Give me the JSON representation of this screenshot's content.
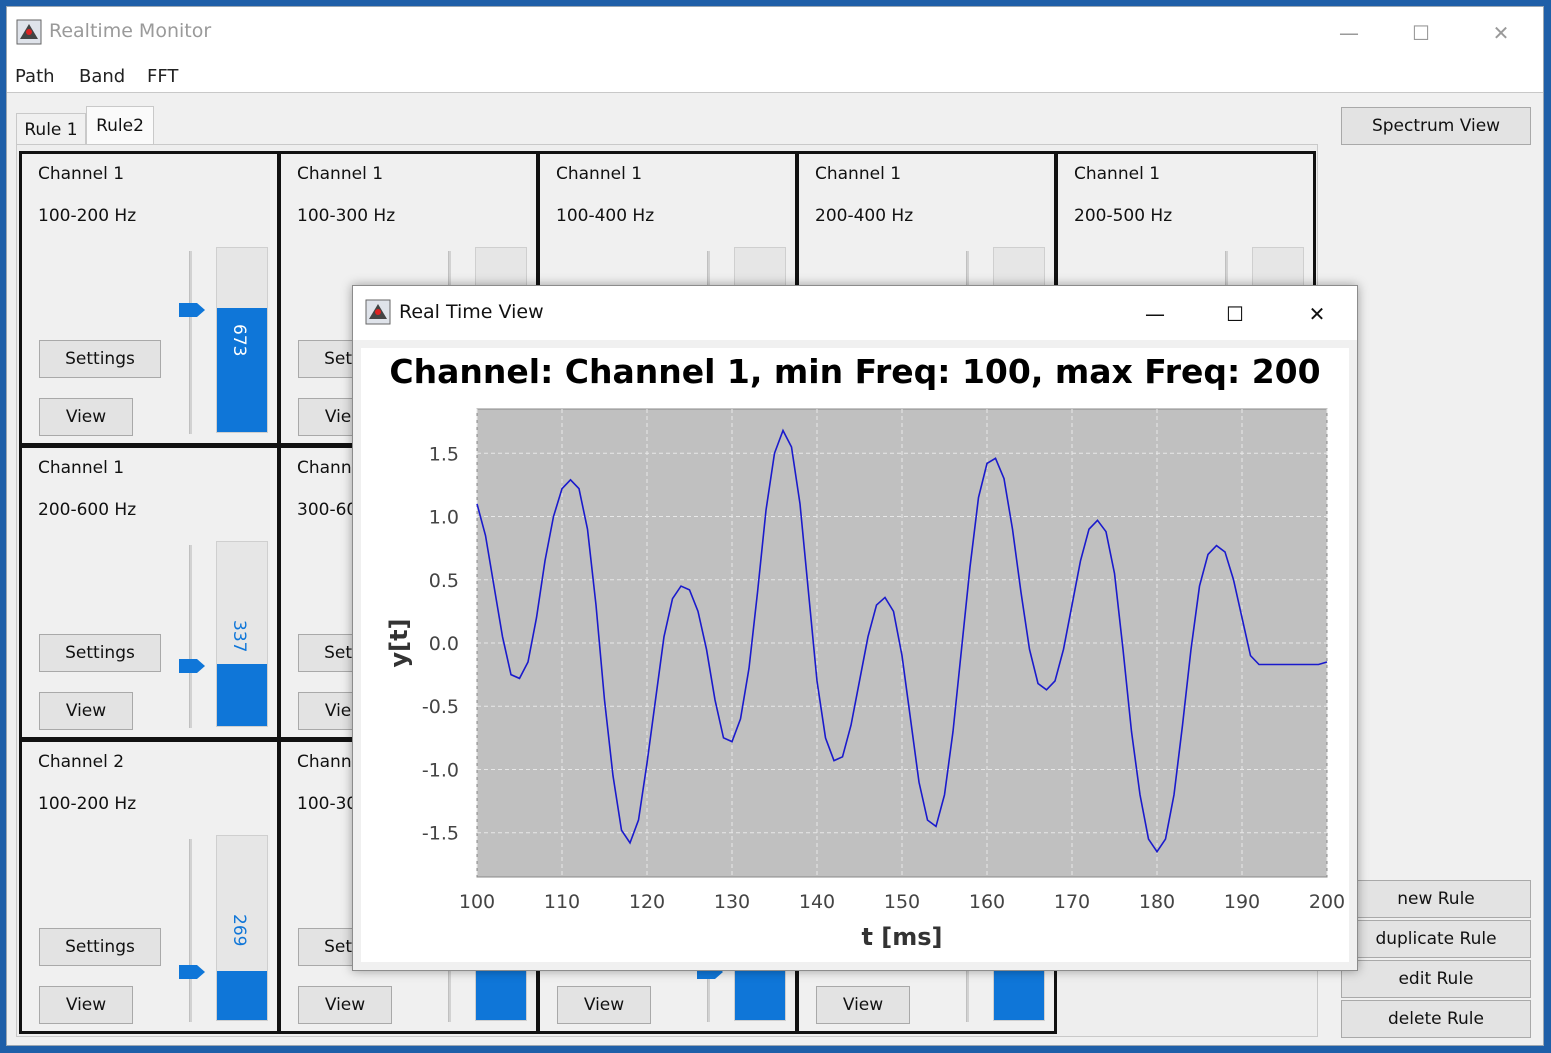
{
  "window": {
    "title": "Realtime Monitor",
    "minimize": "—",
    "maximize": "☐",
    "close": "✕"
  },
  "menu": [
    "Path",
    "Band",
    "FFT"
  ],
  "tabs": [
    "Rule 1",
    "Rule2"
  ],
  "colors": {
    "meter": "#0f76d8",
    "plot_bg": "#c0c0c0",
    "plot_line": "#1a1acc"
  },
  "cells": [
    {
      "channel": "Channel 1",
      "range": "100-200 Hz",
      "settings": "Settings",
      "view": "View",
      "value": "673",
      "level": 0.673
    },
    {
      "channel": "Channel 1",
      "range": "100-300 Hz",
      "settings": "Settings",
      "view": "View"
    },
    {
      "channel": "Channel 1",
      "range": "100-400 Hz"
    },
    {
      "channel": "Channel 1",
      "range": "200-400 Hz"
    },
    {
      "channel": "Channel 1",
      "range": "200-500 Hz"
    },
    {
      "channel": "Channel 1",
      "range": "200-600 Hz",
      "settings": "Settings",
      "view": "View",
      "value": "337",
      "level": 0.337
    },
    {
      "channel": "Channel 1",
      "range": "300-600 Hz",
      "settings": "Settings",
      "view": "View"
    },
    {
      "channel": "Channel 2",
      "range": "100-200 Hz",
      "settings": "Settings",
      "view": "View",
      "value": "269",
      "level": 0.269
    },
    {
      "channel": "Channel 2",
      "range": "100-300 Hz",
      "settings": "Settings",
      "view": "View"
    },
    {
      "view": "View"
    },
    {
      "view": "View"
    }
  ],
  "side_buttons": {
    "spectrum": "Spectrum View",
    "new": "new Rule",
    "duplicate": "duplicate Rule",
    "edit": "edit Rule",
    "delete": "delete Rule"
  },
  "realtime_window": {
    "title": "Real Time View",
    "minimize": "—",
    "maximize": "☐",
    "close": "✕"
  },
  "chart_data": {
    "type": "line",
    "title": "Channel: Channel 1, min Freq: 100, max Freq: 200",
    "xlabel": "t [ms]",
    "ylabel": "y[t]",
    "xlim": [
      100,
      200
    ],
    "ylim": [
      -1.85,
      1.85
    ],
    "xticks": [
      "100",
      "110",
      "120",
      "130",
      "140",
      "150",
      "160",
      "170",
      "180",
      "190",
      "200"
    ],
    "yticks": [
      "1.5",
      "1.0",
      "0.5",
      "0.0",
      "-0.5",
      "-1.0",
      "-1.5"
    ],
    "grid": true,
    "series": [
      {
        "x": [
          100,
          101,
          102,
          103,
          104,
          105,
          106,
          107,
          108,
          109,
          110,
          111,
          112,
          113,
          114,
          115,
          116,
          117,
          118,
          119,
          120,
          121,
          122,
          123,
          124,
          125,
          126,
          127,
          128,
          129,
          130,
          131,
          132,
          133,
          134,
          135,
          136,
          137,
          138,
          139,
          140,
          141,
          142,
          143,
          144,
          145,
          146,
          147,
          148,
          149,
          150,
          151,
          152,
          153,
          154,
          155,
          156,
          157,
          158,
          159,
          160,
          161,
          162,
          163,
          164,
          165,
          166,
          167,
          168,
          169,
          170,
          171,
          172,
          173,
          174,
          175,
          176,
          177,
          178,
          179,
          180,
          181,
          182,
          183,
          184,
          185,
          186,
          187,
          188,
          189,
          190,
          191,
          192,
          193,
          194,
          195,
          196,
          197,
          198,
          199,
          200
        ],
        "y": [
          1.1,
          0.85,
          0.45,
          0.05,
          -0.25,
          -0.28,
          -0.15,
          0.2,
          0.65,
          1.0,
          1.22,
          1.29,
          1.22,
          0.9,
          0.3,
          -0.45,
          -1.05,
          -1.48,
          -1.58,
          -1.4,
          -0.95,
          -0.45,
          0.05,
          0.35,
          0.45,
          0.42,
          0.25,
          -0.05,
          -0.45,
          -0.75,
          -0.78,
          -0.6,
          -0.2,
          0.4,
          1.05,
          1.5,
          1.68,
          1.55,
          1.1,
          0.4,
          -0.3,
          -0.75,
          -0.93,
          -0.9,
          -0.65,
          -0.3,
          0.05,
          0.3,
          0.36,
          0.25,
          -0.1,
          -0.6,
          -1.1,
          -1.4,
          -1.45,
          -1.2,
          -0.7,
          -0.05,
          0.6,
          1.15,
          1.42,
          1.46,
          1.3,
          0.9,
          0.4,
          -0.05,
          -0.32,
          -0.37,
          -0.3,
          -0.05,
          0.3,
          0.65,
          0.9,
          0.97,
          0.88,
          0.55,
          -0.05,
          -0.7,
          -1.2,
          -1.55,
          -1.65,
          -1.55,
          -1.2,
          -0.65,
          -0.05,
          0.45,
          0.7,
          0.77,
          0.72,
          0.5,
          0.2,
          -0.1,
          -0.17,
          -0.17,
          -0.17,
          -0.17,
          -0.17,
          -0.17,
          -0.17,
          -0.17,
          -0.15
        ]
      }
    ]
  }
}
